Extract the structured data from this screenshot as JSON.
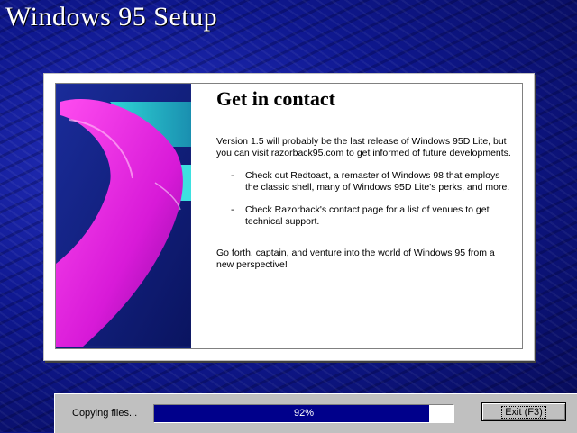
{
  "window": {
    "title": "Windows 95 Setup"
  },
  "dialog": {
    "heading": "Get in contact",
    "paragraph1": "Version 1.5 will probably be the last release of Windows 95D Lite, but you can visit razorback95.com to get informed of future developments.",
    "bullets": [
      "Check out Redtoast, a remaster of Windows 98 that employs the classic shell, many of Windows 95D Lite's perks, and more.",
      "Check Razorback's contact page for a list of venues to get technical support."
    ],
    "bullet_marker": "-",
    "paragraph_last": "Go forth, captain, and venture into the world of Windows 95 from a new perspective!"
  },
  "status": {
    "label": "Copying files...",
    "progress_percent": 92,
    "progress_text": "92%"
  },
  "buttons": {
    "exit_label": "Exit (F3)"
  },
  "colors": {
    "progress_fill": "#00008b",
    "dialog_bg": "#ffffff",
    "bar_bg": "#c0c0c0"
  }
}
